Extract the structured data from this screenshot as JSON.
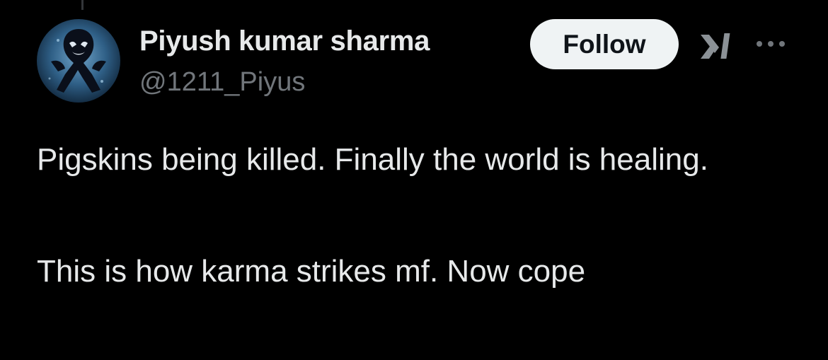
{
  "author": {
    "display_name": "Piyush kumar sharma",
    "handle": "@1211_Piyus"
  },
  "actions": {
    "follow_label": "Follow",
    "grok_icon": "grok-icon",
    "more_icon": "more-horizontal-icon"
  },
  "tweet": {
    "paragraph_1": "Pigskins being killed. Finally the world is healing.",
    "paragraph_2": "This is how karma strikes mf. Now cope"
  },
  "colors": {
    "background": "#000000",
    "primary_text": "#e7e9ea",
    "secondary_text": "#71767b",
    "follow_bg": "#eff3f4",
    "follow_text": "#0f1419"
  }
}
